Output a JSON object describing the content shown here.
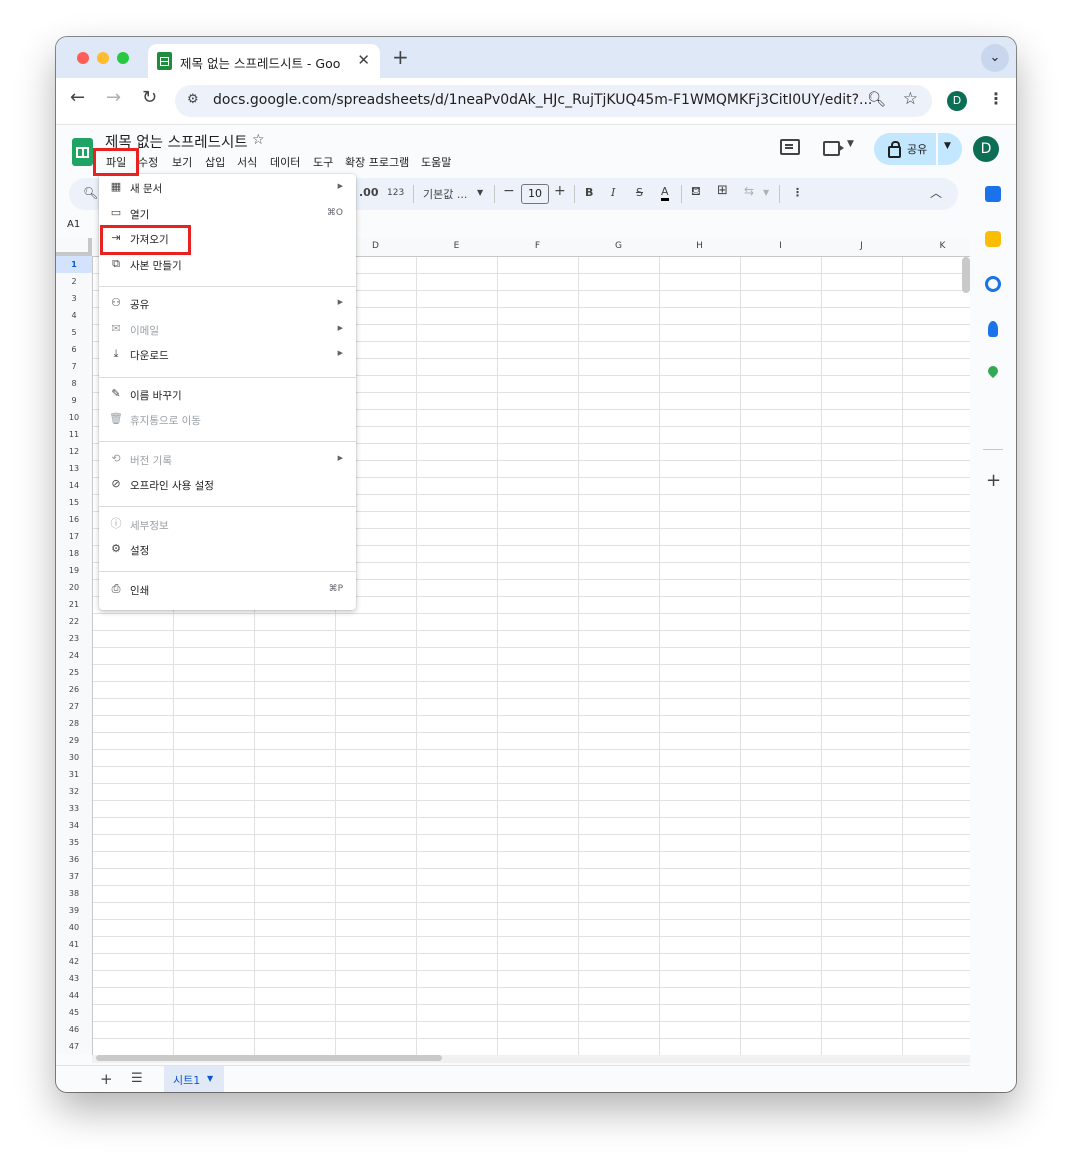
{
  "browser": {
    "tab_title": "제목 없는 스프레드시트 - Google",
    "url": "docs.google.com/spreadsheets/d/1neaPv0dAk_HJc_RujTjKUQ45m-F1WMQMKFj3CitI0UY/edit?...",
    "profile_initial": "D"
  },
  "doc": {
    "title": "제목 없는 스프레드시트",
    "menus": [
      "파일",
      "수정",
      "보기",
      "삽입",
      "서식",
      "데이터",
      "도구",
      "확장 프로그램",
      "도움말"
    ],
    "share_label": "공유",
    "avatar_initial": "D"
  },
  "toolbar": {
    "decimal_more": ".00",
    "number_format": "123",
    "font_name": "기본값 ...",
    "font_size": "10",
    "minus": "−",
    "plus": "+",
    "bold": "B",
    "italic": "I",
    "strike": "S",
    "text_color": "A"
  },
  "name_box": "A1",
  "columns": [
    "D",
    "E",
    "F",
    "G",
    "H",
    "I",
    "J",
    "K"
  ],
  "rows": [
    "1",
    "2",
    "3",
    "4",
    "5",
    "6",
    "7",
    "8",
    "9",
    "10",
    "11",
    "12",
    "13",
    "14",
    "15",
    "16",
    "17",
    "18",
    "19",
    "20",
    "21",
    "22",
    "23",
    "24",
    "25",
    "26",
    "27",
    "28",
    "29",
    "30",
    "31",
    "32",
    "33",
    "34",
    "35",
    "36",
    "37",
    "38",
    "39",
    "40",
    "41",
    "42",
    "43",
    "44",
    "45",
    "46",
    "47"
  ],
  "sheet_tab": "시트1",
  "file_menu": {
    "new": "새 문서",
    "open": "열기",
    "open_shortcut": "⌘O",
    "import": "가져오기",
    "make_copy": "사본 만들기",
    "share": "공유",
    "email": "이메일",
    "download": "다운로드",
    "rename": "이름 바꾸기",
    "move_to_trash": "휴지통으로 이동",
    "version_history": "버전 기록",
    "offline": "오프라인 사용 설정",
    "details": "세부정보",
    "settings": "설정",
    "print": "인쇄",
    "print_shortcut": "⌘P"
  },
  "colors": {
    "highlight": "#e8231f",
    "share_button": "#c2e7ff",
    "sheets_green": "#1fa463"
  }
}
